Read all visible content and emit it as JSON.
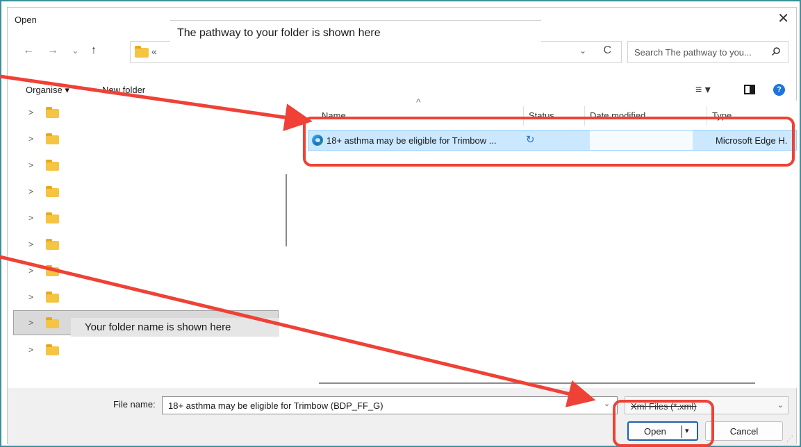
{
  "dialog": {
    "title": "Open",
    "close_symbol": "✕"
  },
  "nav": {
    "back": "←",
    "forward": "→",
    "recent": "⌄",
    "up": "↑"
  },
  "address": {
    "chevron": "«",
    "dropdown": "⌄",
    "refresh": "C",
    "path_overlay": "The pathway to your folder is shown here"
  },
  "search": {
    "placeholder": "Search The pathway to you...",
    "icon": "search-icon"
  },
  "toolbar": {
    "organise": "Organise ▾",
    "new_folder": "New folder",
    "view": "≡ ▾",
    "help": "?"
  },
  "tree": {
    "chevron": ">",
    "folder_overlay": "Your folder name is shown here",
    "selected_index": 8,
    "item_count": 10
  },
  "list": {
    "sort_indicator": "^",
    "columns": [
      "Name",
      "Status",
      "Date modified",
      "Type"
    ],
    "rows": [
      {
        "name": "18+ asthma may be eligible for Trimbow ...",
        "status_icon": "sync-icon",
        "status_symbol": "↻",
        "date_modified": "",
        "type": "Microsoft Edge H."
      }
    ]
  },
  "footer": {
    "file_name_label": "File name:",
    "file_name_value": "18+ asthma may be eligible for Trimbow (BDP_FF_G)",
    "filter_value": "Xml Files (*.xml)",
    "dropdown": "⌄",
    "open_label": "Open",
    "open_dropdown": "▾",
    "cancel_label": "Cancel",
    "grip": "⋰"
  },
  "colors": {
    "annotation": "#ef4136",
    "selection": "#cce8ff",
    "accent": "#1f5fad",
    "frame": "#3b8f9c",
    "folder": "#f5c542"
  }
}
